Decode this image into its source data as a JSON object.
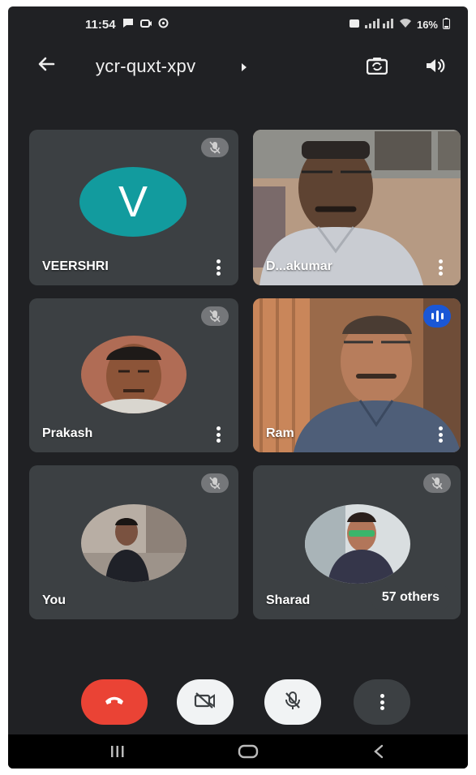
{
  "status_bar": {
    "time": "11:54",
    "right_text": "16%"
  },
  "meeting": {
    "code": "ycr-quxt-xpv"
  },
  "participants": [
    {
      "name": "VEERSHRI",
      "avatar_letter": "V",
      "muted": true
    },
    {
      "name": "D...akumar",
      "muted": false
    },
    {
      "name": "Prakash",
      "muted": true
    },
    {
      "name": "Ram",
      "speaking": true
    },
    {
      "name": "You",
      "muted": true
    },
    {
      "name": "Sharad",
      "muted": true
    }
  ],
  "others_label": "57 others",
  "colors": {
    "background": "#202124",
    "tile": "#3c4043",
    "end_call": "#ea4335",
    "avatar_teal": "#129b9e",
    "speaking_badge": "#1a57d6"
  },
  "icons": {
    "back": "arrow-left-icon",
    "switch_camera": "switch-camera-icon",
    "speaker": "speaker-icon",
    "end_call": "phone-hangup-icon",
    "camera_off": "camera-off-icon",
    "mic_off": "mic-off-icon",
    "more": "more-vertical-icon"
  }
}
